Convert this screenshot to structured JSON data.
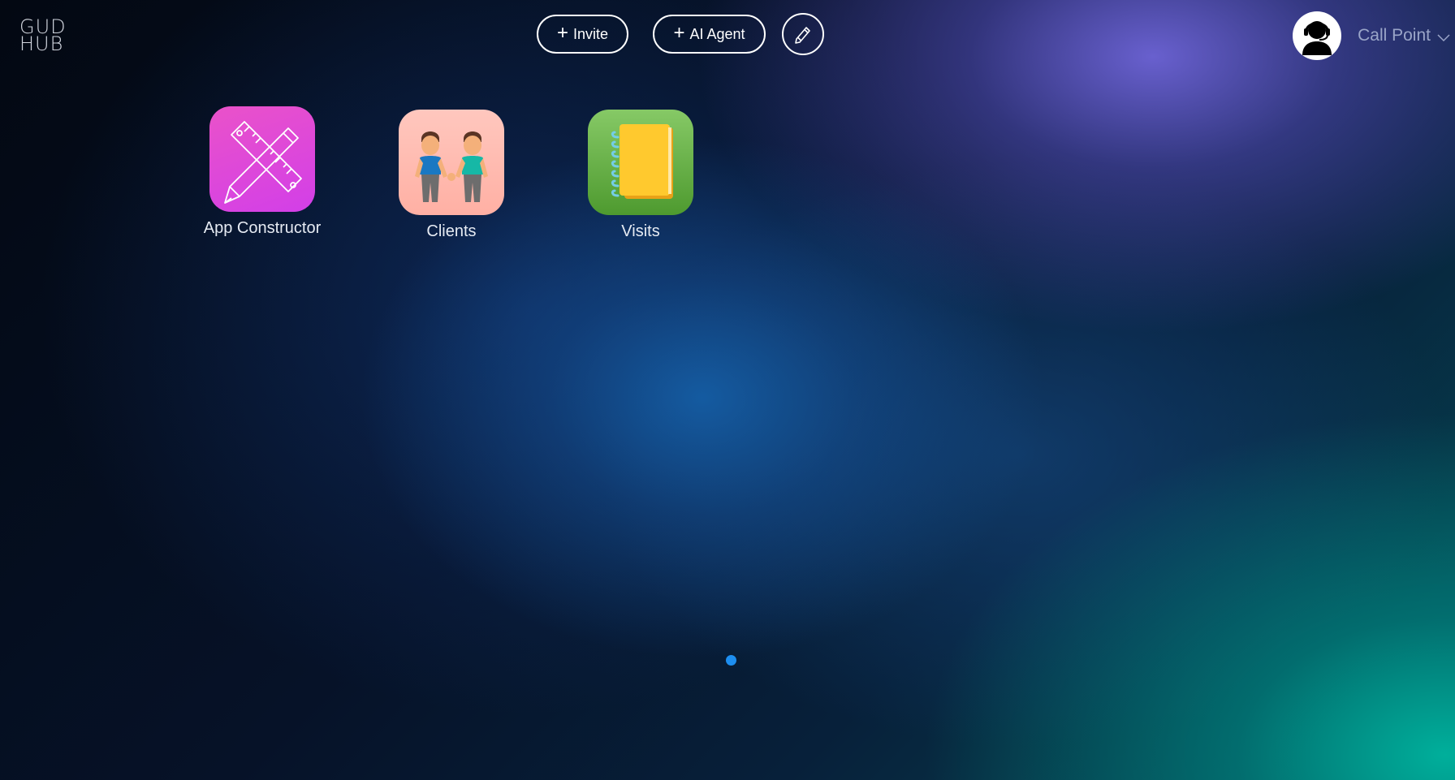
{
  "logo": {
    "line1": "GUD",
    "line2": "HUB"
  },
  "toolbar": {
    "invite_label": "Invite",
    "ai_agent_label": "AI Agent",
    "edit_icon": "pencil-icon"
  },
  "user": {
    "name": "Call Point",
    "avatar_icon": "support-agent-icon",
    "dropdown_icon": "chevron-down-icon"
  },
  "apps": [
    {
      "label": "App Constructor",
      "icon": "pencil-ruler-icon",
      "color": "#d23fe8"
    },
    {
      "label": "Clients",
      "icon": "two-men-holding-hands-icon",
      "color": "#ffb8ad"
    },
    {
      "label": "Visits",
      "icon": "notebook-icon",
      "color": "#5fab3b"
    }
  ],
  "pagination": {
    "pages": 1,
    "current": 1,
    "color": "#1d8ef0"
  }
}
